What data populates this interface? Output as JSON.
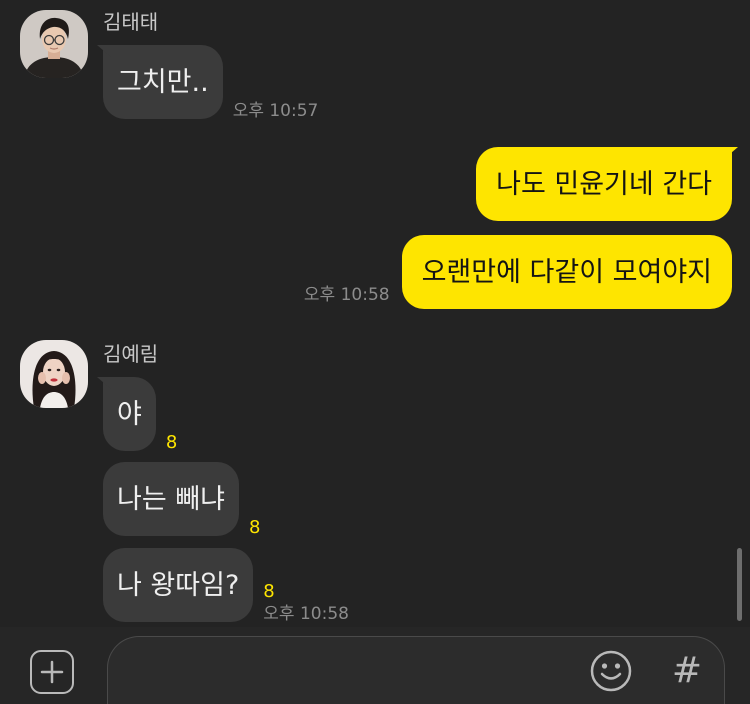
{
  "theme": {
    "chat_background": "#232323",
    "composer_background": "#262626",
    "incoming_bubble": "#3b3b3b",
    "outgoing_bubble": "#FEE500",
    "unread_color": "#FEE500",
    "timestamp_color": "#8c8c8c",
    "name_color": "#c8c8c8"
  },
  "incoming_group_1": {
    "sender_name": "김태태",
    "avatar_icon": "profile-photo-icon",
    "messages": [
      {
        "text": "그치만..",
        "time": "오후 10:57"
      }
    ]
  },
  "outgoing_group": {
    "messages": [
      {
        "text": "나도 민윤기네 간다"
      },
      {
        "text": "오랜만에 다같이 모여야지",
        "time": "오후 10:58"
      }
    ]
  },
  "incoming_group_2": {
    "sender_name": "김예림",
    "avatar_icon": "profile-photo-icon",
    "messages": [
      {
        "text": "야",
        "unread": 8
      },
      {
        "text": "나는 빼냐",
        "unread": 8
      },
      {
        "text": "나 왕따임?",
        "unread": 8,
        "time": "오후 10:58"
      }
    ]
  },
  "composer": {
    "input_value": "",
    "add_icon": "plus-square-icon",
    "emoji_icon": "smiley-icon",
    "hash_icon": "hash-icon",
    "hash_glyph": "#"
  }
}
